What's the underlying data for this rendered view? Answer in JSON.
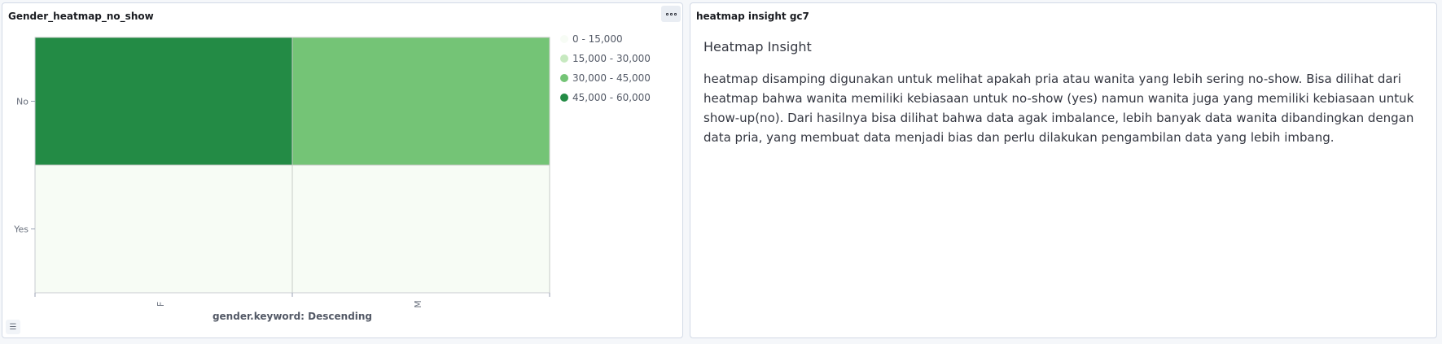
{
  "left_panel": {
    "title": "Gender_heatmap_no_show"
  },
  "right_panel": {
    "title": "heatmap insight gc7",
    "heading": "Heatmap Insight",
    "paragraph": "heatmap disamping digunakan untuk melihat apakah pria atau wanita yang lebih sering no-show. Bisa dilihat dari heatmap bahwa wanita memiliki kebiasaan untuk no-show (yes) namun wanita juga yang memiliki kebiasaan untuk show-up(no). Dari hasilnya bisa dilihat bahwa data agak imbalance, lebih banyak data wanita dibandingkan dengan data pria, yang membuat data menjadi bias dan perlu dilakukan pengambilan data yang lebih imbang."
  },
  "icons": {
    "options": "ellipsis-icon",
    "legend_toggle": "list-icon"
  },
  "chart_data": {
    "type": "heatmap",
    "x_categories": [
      "F",
      "M"
    ],
    "y_categories": [
      "No",
      "Yes"
    ],
    "xlabel": "gender.keyword: Descending",
    "values": [
      {
        "x": "F",
        "y": "No",
        "range": "45,000 - 60,000"
      },
      {
        "x": "M",
        "y": "No",
        "range": "30,000 - 45,000"
      },
      {
        "x": "F",
        "y": "Yes",
        "range": "0 - 15,000"
      },
      {
        "x": "M",
        "y": "Yes",
        "range": "0 - 15,000"
      }
    ],
    "legend": [
      {
        "label": "0 - 15,000",
        "color": "#f7fcf5"
      },
      {
        "label": "15,000 - 30,000",
        "color": "#c7e9c0"
      },
      {
        "label": "30,000 - 45,000",
        "color": "#74c476"
      },
      {
        "label": "45,000 - 60,000",
        "color": "#238b45"
      }
    ],
    "legend_position": "right"
  }
}
